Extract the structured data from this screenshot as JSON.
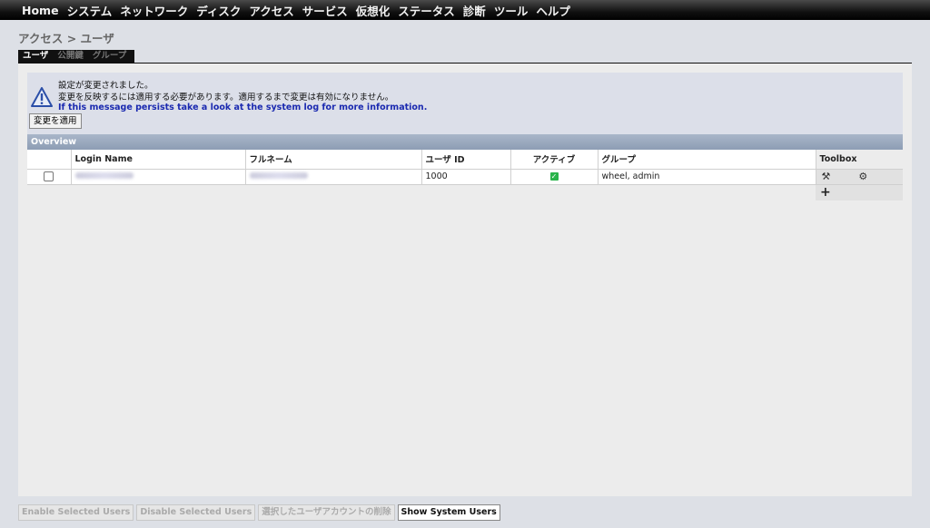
{
  "nav": {
    "items": [
      "Home",
      "システム",
      "ネットワーク",
      "ディスク",
      "アクセス",
      "サービス",
      "仮想化",
      "ステータス",
      "診断",
      "ツール",
      "ヘルプ"
    ]
  },
  "breadcrumb": "アクセス > ユーザ",
  "tabs": [
    {
      "label": "ユーザ",
      "active": true
    },
    {
      "label": "公開鍵",
      "active": false
    },
    {
      "label": "グループ",
      "active": false
    }
  ],
  "notice": {
    "line1": "設定が変更されました。",
    "line2": "変更を反映するには適用する必要があります。適用するまで変更は有効になりません。",
    "line3": "If this message persists take a look at the system log for more information.",
    "apply_button": "変更を適用"
  },
  "overview": {
    "title": "Overview",
    "columns": [
      "",
      "Login Name",
      "フルネーム",
      "ユーザ ID",
      "アクティブ",
      "グループ",
      "Toolbox"
    ],
    "rows": [
      {
        "user_id": "1000",
        "active": true,
        "groups": "wheel, admin"
      }
    ]
  },
  "bottom_buttons": [
    {
      "label": "Enable Selected Users",
      "enabled": false
    },
    {
      "label": "Disable Selected Users",
      "enabled": false
    },
    {
      "label": "選択したユーザアカウントの削除",
      "enabled": false
    },
    {
      "label": "Show System Users",
      "enabled": true
    }
  ],
  "colors": {
    "notice_link": "#1a29b0",
    "header_bar": "#8d9db4",
    "active_check": "#2ab34b"
  }
}
